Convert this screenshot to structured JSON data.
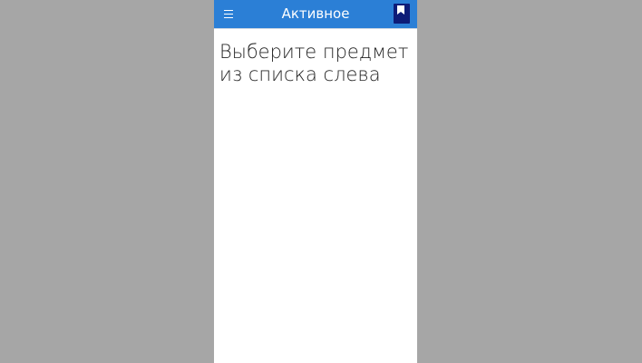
{
  "header": {
    "title": "Активное",
    "menu_icon": "hamburger-menu-icon",
    "bookmark_icon": "bookmark-icon",
    "background_color": "#2b7fd6",
    "bookmark_color": "#0d1c78"
  },
  "main": {
    "message": "Выберите предмет из списка слева"
  },
  "colors": {
    "backdrop": "#a6a6a6",
    "content_background": "#ffffff"
  }
}
